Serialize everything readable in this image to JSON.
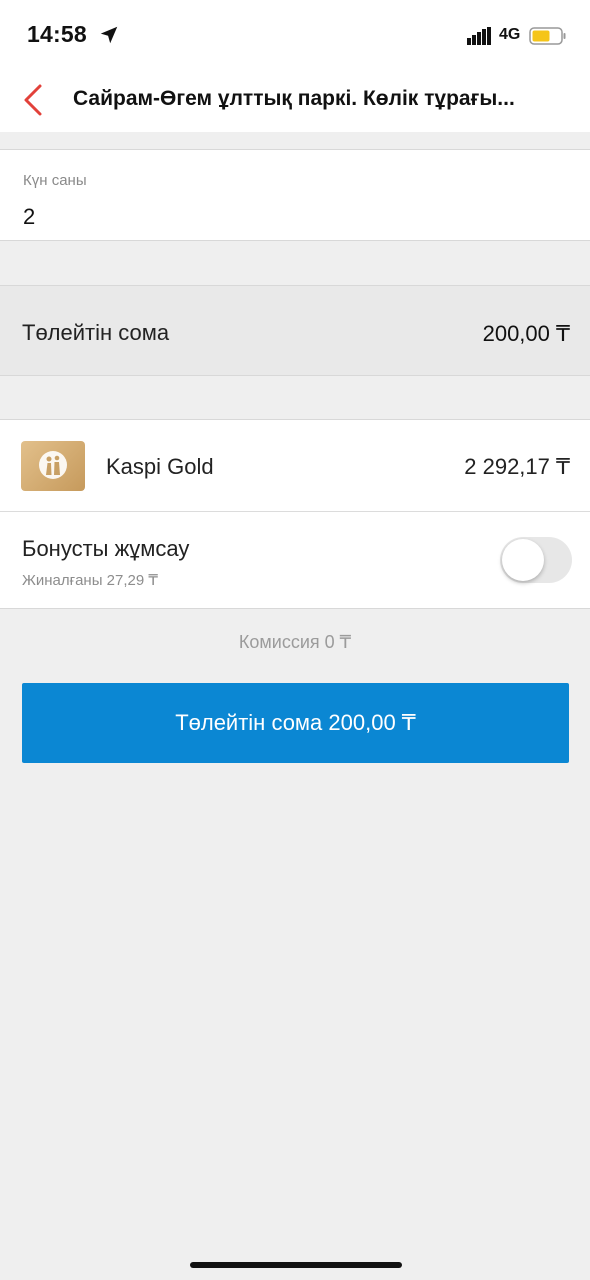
{
  "status_bar": {
    "time": "14:58",
    "network": "4G",
    "icons": [
      "location-arrow-icon",
      "signal-icon",
      "battery-icon"
    ],
    "battery_color": "#f5c518"
  },
  "header": {
    "title": "Сайрам-Өгем ұлттық паркі. Көлік тұрағы...",
    "back_icon": "chevron-left-icon",
    "accent": "#e2413a"
  },
  "form": {
    "days_label": "Күн саны",
    "days_value": "2"
  },
  "summary": {
    "label": "Төлейтін сома",
    "amount": "200,00 ₸"
  },
  "payment_source": {
    "card_name": "Kaspi Gold",
    "balance": "2 292,17 ₸",
    "bonus_label": "Бонусты жұмсау",
    "bonus_accumulated": "Жиналғаны 27,29 ₸",
    "bonus_enabled": false
  },
  "commission": "Комиссия 0 ₸",
  "pay_button": {
    "label": "Төлейтін сома 200,00 ₸",
    "color": "#0b87d3"
  }
}
